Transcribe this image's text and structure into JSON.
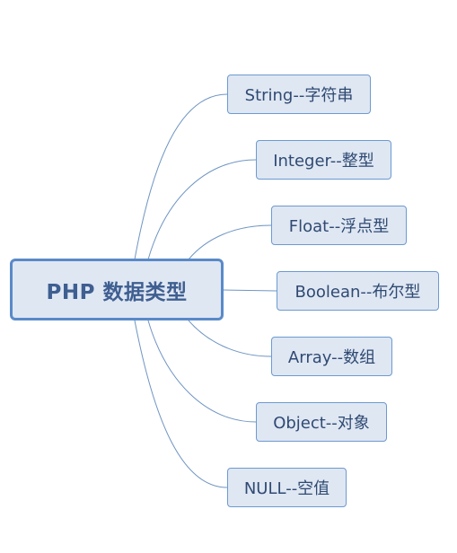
{
  "root": {
    "label": "PHP 数据类型"
  },
  "children": [
    {
      "label": "String--字符串"
    },
    {
      "label": "Integer--整型"
    },
    {
      "label": "Float--浮点型"
    },
    {
      "label": "Boolean--布尔型"
    },
    {
      "label": "Array--数组"
    },
    {
      "label": "Object--对象"
    },
    {
      "label": "NULL--空值"
    }
  ],
  "colors": {
    "node_fill": "#dfe7f3",
    "root_border": "#5a8ac8",
    "child_border": "#6c9ad0",
    "connector": "#6f95c3",
    "root_text": "#3f5f91",
    "child_text": "#2f4a72"
  }
}
